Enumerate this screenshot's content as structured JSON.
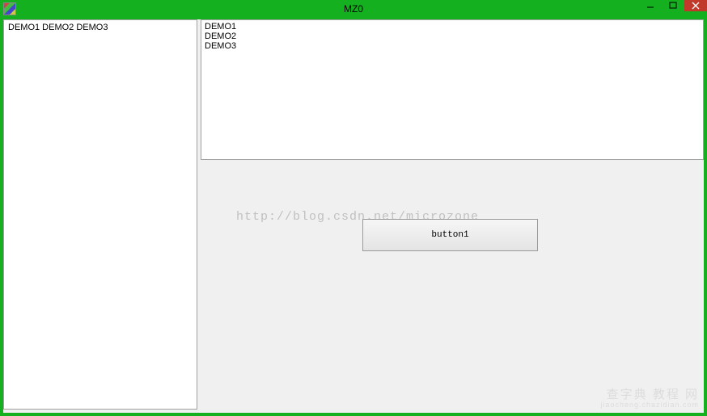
{
  "window": {
    "title": "MZ0"
  },
  "leftPanel": {
    "text": "DEMO1  DEMO2  DEMO3"
  },
  "textbox": {
    "lines": [
      "DEMO1",
      "DEMO2",
      "DEMO3"
    ]
  },
  "watermark": "http://blog.csdn.net/microzone",
  "button1": {
    "label": "button1"
  },
  "cornerWatermark": {
    "line1": "查字典 教程 网",
    "line2": "jiaocheng.chazidian.com"
  }
}
